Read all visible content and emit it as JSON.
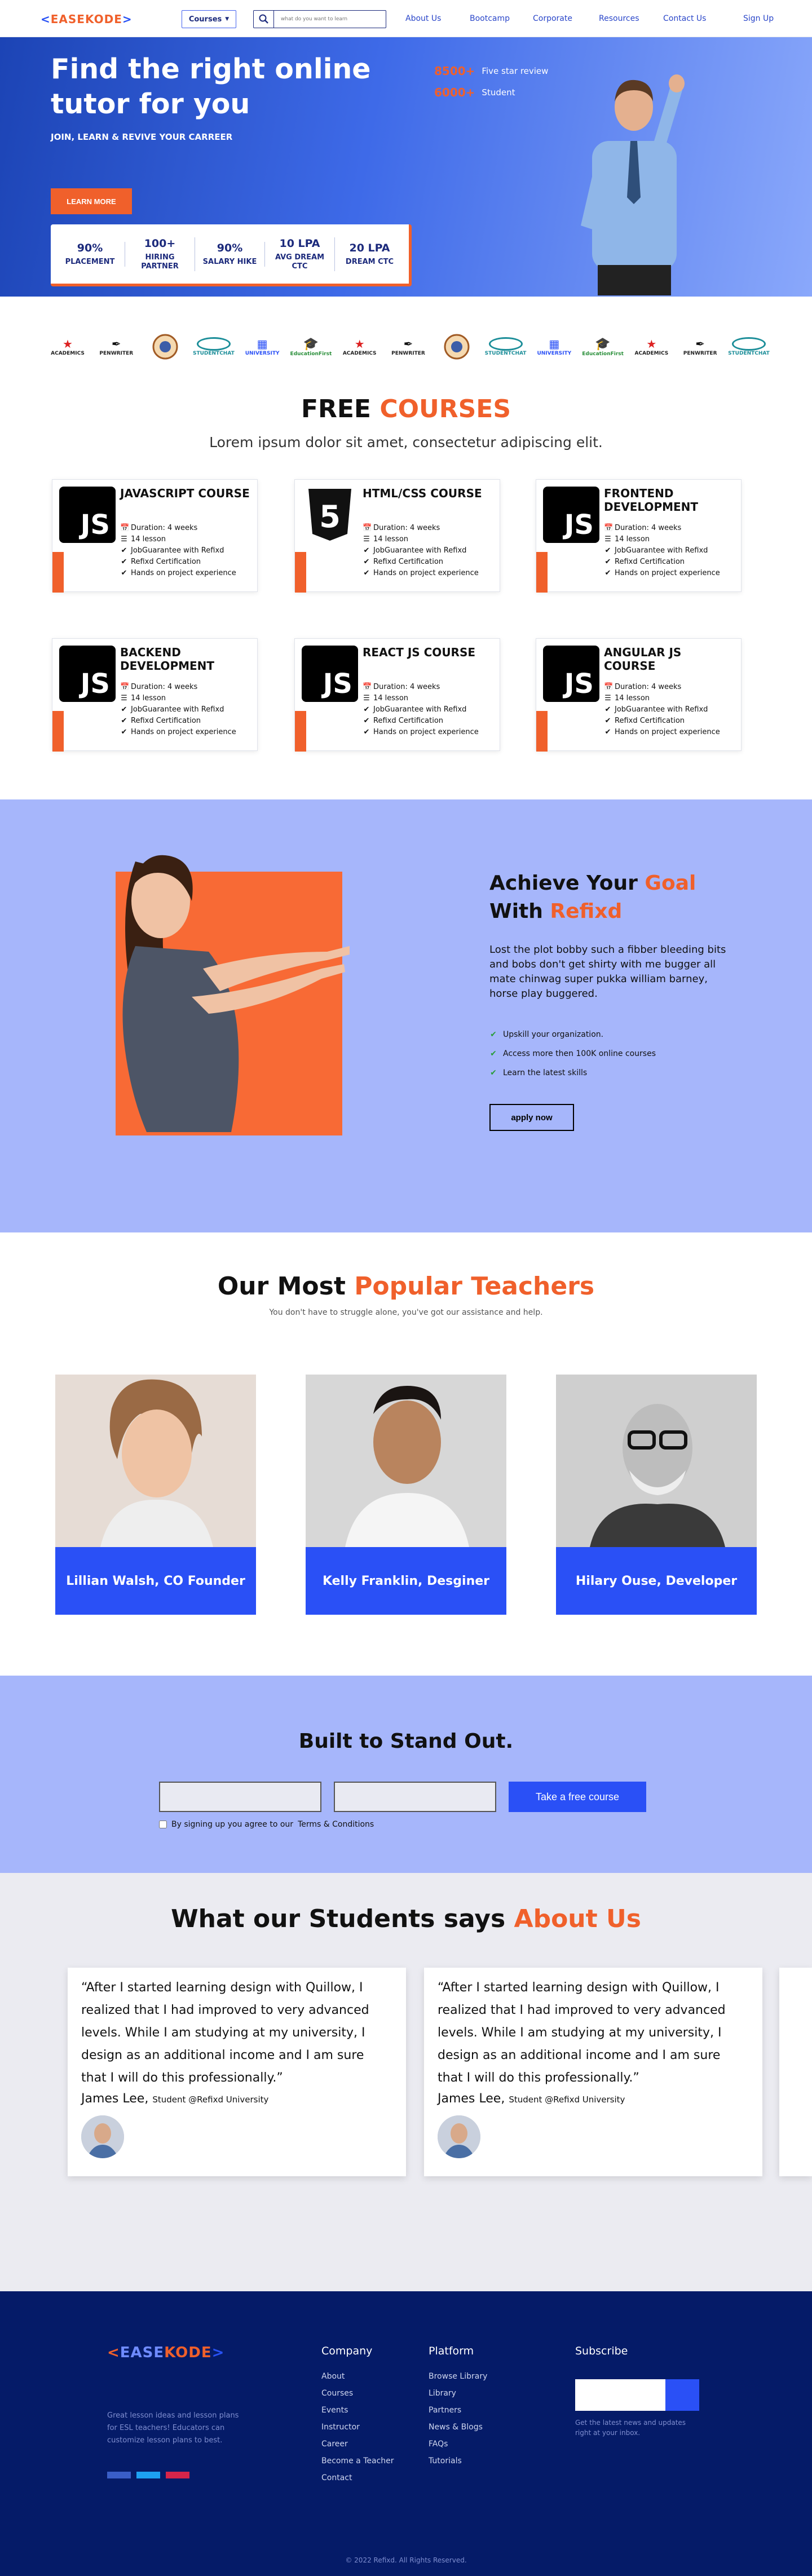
{
  "nav": {
    "logo_lt": "<",
    "logo_a": "EASE",
    "logo_b": "KODE",
    "logo_gt": ">",
    "courses": "Courses",
    "search_placeholder": "what do you want to learn",
    "links": [
      "About Us",
      "Bootcamp",
      "Corporate",
      "Resources",
      "Contact Us"
    ],
    "signup": "Sign Up"
  },
  "hero": {
    "title": "Find the right online tutor for you",
    "subtitle": "JOIN, LEARN & REVIVE YOUR CARREER",
    "cta": "LEARN MORE",
    "stats": [
      {
        "value": "90%",
        "label": "PLACEMENT"
      },
      {
        "value": "100+",
        "label": "HIRING PARTNER"
      },
      {
        "value": "90%",
        "label": "SALARY HIKE"
      },
      {
        "value": "10 LPA",
        "label": "AVG DREAM CTC"
      },
      {
        "value": "20 LPA",
        "label": "DREAM CTC"
      }
    ],
    "side_stats": [
      {
        "number": "8500+",
        "label": "Five star review"
      },
      {
        "number": "6000+",
        "label": "Student"
      }
    ]
  },
  "badges": [
    "ACADEMICS",
    "PENWRITER",
    "",
    "STUDENTCHAT",
    "UNIVERSITY",
    "EducationFirst",
    "ACADEMICS",
    "PENWRITER",
    "",
    "STUDENTCHAT",
    "UNIVERSITY",
    "EducationFirst",
    "ACADEMICS",
    "PENWRITER",
    "STUDENTCHAT"
  ],
  "courses": {
    "title_a": "FREE ",
    "title_b": "COURSES",
    "subtitle": "Lorem ipsum dolor sit amet, consectetur adipiscing elit.",
    "items": [
      {
        "title": "JAVASCRIPT COURSE",
        "logo": "JS"
      },
      {
        "title": "HTML/CSS COURSE",
        "logo": "5"
      },
      {
        "title": "FRONTEND DEVELOPMENT",
        "logo": "JS"
      },
      {
        "title": "BACKEND DEVELOPMENT",
        "logo": "JS"
      },
      {
        "title": "REACT JS COURSE",
        "logo": "JS"
      },
      {
        "title": "ANGULAR JS COURSE",
        "logo": "JS"
      }
    ],
    "duration": "Duration: 4 weeks",
    "lessons": "14 lesson",
    "features": [
      "JobGuarantee with Refixd",
      "Refixd Certification",
      "Hands on project experience"
    ]
  },
  "achieve": {
    "h1a": "Achieve Your ",
    "h1b": "Goal",
    "h2a": "With ",
    "h2b": "Refixd",
    "paragraph": "Lost the plot bobby such a fibber bleeding bits and bobs don't get shirty with me bugger all mate chinwag super pukka william barney, horse play buggered.",
    "list": [
      "Upskill your organization.",
      "Access more then 100K online courses",
      "Learn the latest skills"
    ],
    "cta": "apply now"
  },
  "teachers": {
    "title_a": "Our Most ",
    "title_b": "Popular Teachers",
    "subtitle": "You don't have to struggle alone, you've got our assistance and help.",
    "items": [
      "Lillian Walsh, CO Founder",
      "Kelly Franklin, Desginer",
      "Hilary Ouse, Developer"
    ]
  },
  "built": {
    "title": "Built to Stand Out.",
    "cta": "Take a free course",
    "agree": "By signing up you agree to our",
    "terms": "Terms & Conditions"
  },
  "testimonials": {
    "title_a": "What our Students says ",
    "title_b": "About Us",
    "quote": "“After I started learning design with Quillow, I realized that I had improved to very advanced levels. While I am studying at my university, I design as an additional income and I am sure that I will do this professionally.”",
    "name": "James Lee,",
    "role": "Student @Refixd University"
  },
  "footer": {
    "description": "Great lesson ideas and lesson plans for ESL teachers! Educators can customize lesson plans to best.",
    "company_title": "Company",
    "company": [
      "About",
      "Courses",
      "Events",
      "Instructor",
      "Career",
      "Become a Teacher",
      "Contact"
    ],
    "platform_title": "Platform",
    "platform": [
      "Browse Library",
      "Library",
      "Partners",
      "News & Blogs",
      "FAQs",
      "Tutorials"
    ],
    "subscribe_title": "Subscribe",
    "subscribe_note": "Get the latest news and updates right at your inbox.",
    "copyright": "© 2022 Refixd. All Rights Reserved."
  },
  "colors": {
    "primary": "#2a50f6",
    "accent": "#f0602b",
    "footer": "#051b68",
    "lavender": "#a6b6fb"
  }
}
